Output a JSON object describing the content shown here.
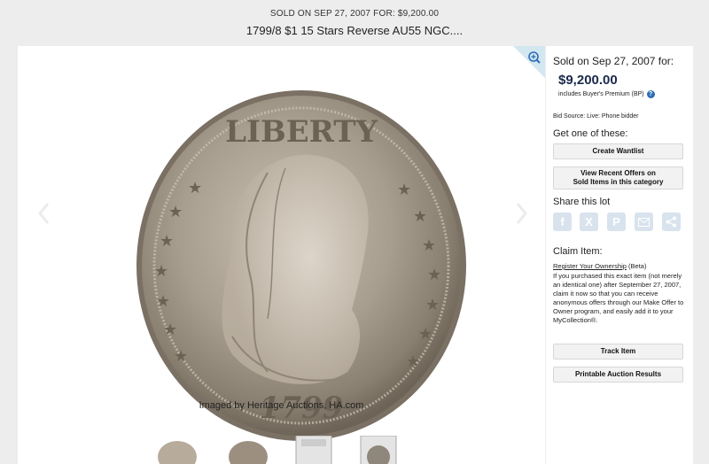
{
  "header": {
    "sold_line": "SOLD ON SEP 27, 2007 FOR: $9,200.00",
    "title": "1799/8 $1 15 Stars Reverse AU55 NGC...."
  },
  "image_panel": {
    "coin_legend": "LIBERTY",
    "coin_date": "1799",
    "credit": "Imaged by Heritage Auctions, HA.com"
  },
  "sidebar": {
    "sold_label": "Sold on Sep 27, 2007 for:",
    "price": "$9,200.00",
    "bp_note": "includes Buyer's Premium (BP)",
    "bid_source": "Bid Source: Live: Phone bidder",
    "get_one": "Get one of these:",
    "create_wantlist": "Create Wantlist",
    "recent_offers_line1": "View Recent Offers on",
    "recent_offers_line2": "Sold Items in this category",
    "share_label": "Share this lot",
    "claim_label": "Claim Item:",
    "register_link": "Register Your Ownership",
    "register_beta": " (Beta)",
    "claim_text": "If you purchased this exact item (not merely an identical one) after September 27, 2007, claim it now so that you can receive anonymous offers through our Make Offer to Owner program, and easily add it to your MyCollection®.",
    "track_item": "Track Item",
    "printable_results": "Printable Auction Results"
  },
  "share_icons": [
    "facebook-icon",
    "x-icon",
    "pinterest-icon",
    "email-icon",
    "share-icon"
  ],
  "colors": {
    "price": "#1b2a4a",
    "share_icon_bg": "#d8e3ee",
    "help_icon": "#2f6db5",
    "zoom_corner": "#d3e7f1"
  }
}
